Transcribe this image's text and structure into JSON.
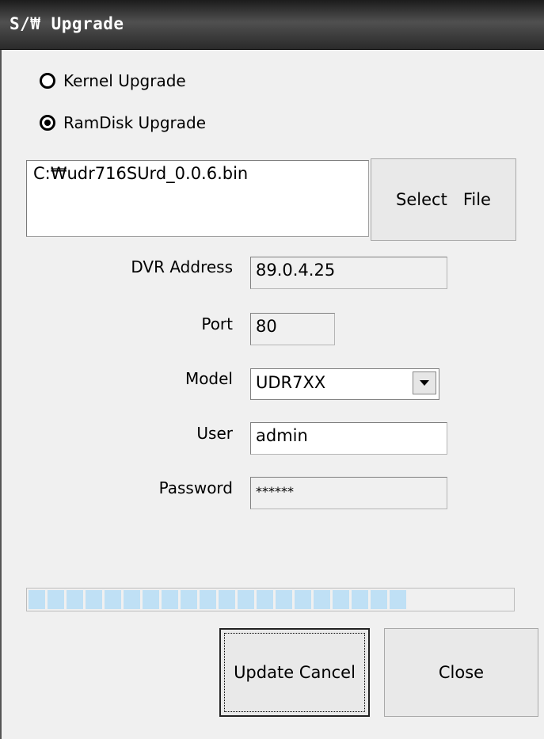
{
  "window": {
    "title": "S/₩ Upgrade"
  },
  "upgrade_type": {
    "options": [
      {
        "label": "Kernel Upgrade",
        "selected": false
      },
      {
        "label": "RamDisk Upgrade",
        "selected": true
      }
    ]
  },
  "file": {
    "path": "C:₩udr716SUrd_0.0.6.bin",
    "select_button": "Select   File"
  },
  "form": {
    "dvr_address": {
      "label": "DVR Address",
      "value": "89.0.4.25"
    },
    "port": {
      "label": "Port",
      "value": "80"
    },
    "model": {
      "label": "Model",
      "value": "UDR7XX"
    },
    "user": {
      "label": "User",
      "value": "admin"
    },
    "password": {
      "label": "Password",
      "value": "******"
    }
  },
  "progress": {
    "percent": 78
  },
  "buttons": {
    "update_cancel": "Update Cancel",
    "close": "Close"
  },
  "colors": {
    "progress_fill": "#bfe0f5",
    "titlebar": "#2a2a2a",
    "background": "#f0f0f0"
  }
}
